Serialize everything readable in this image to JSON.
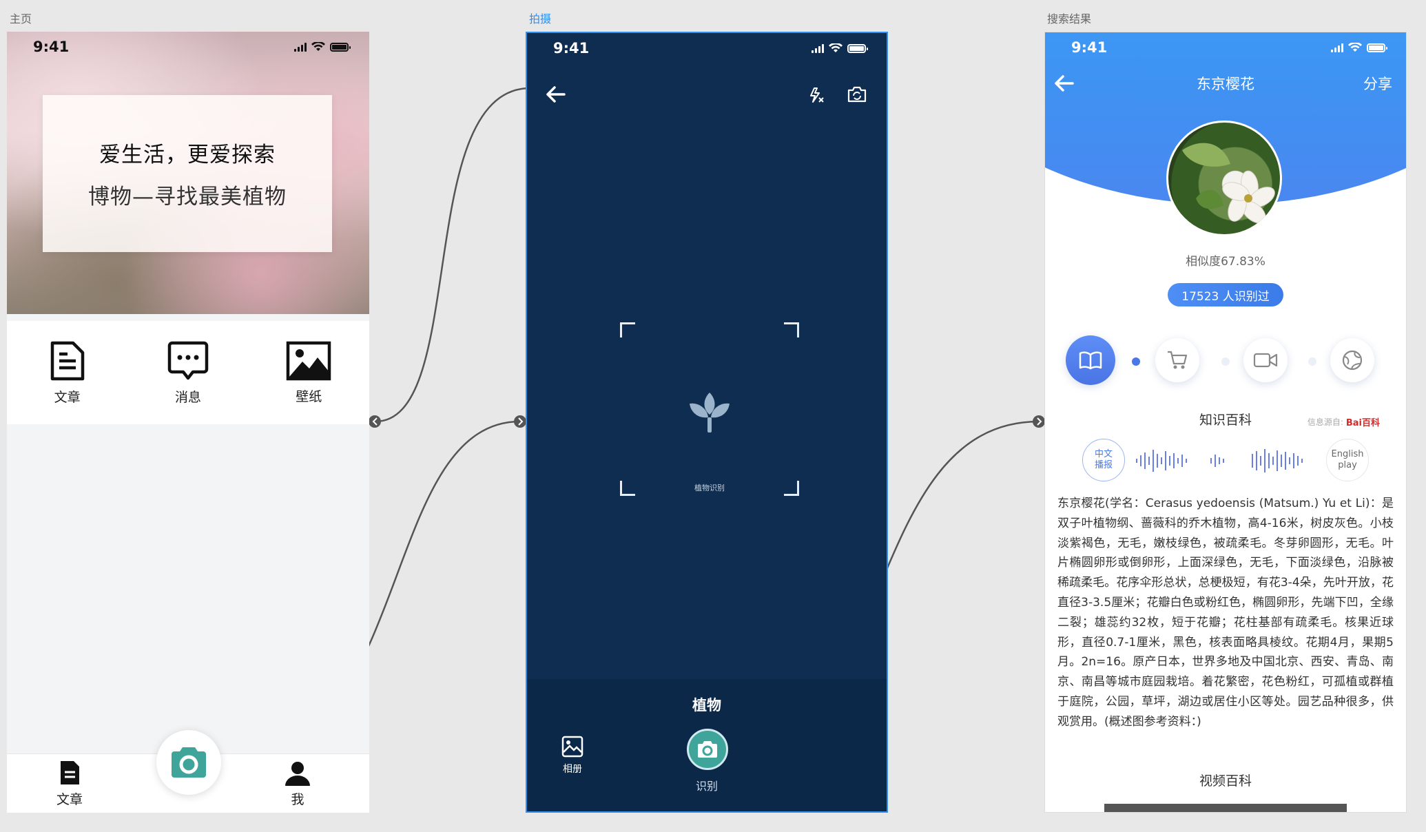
{
  "frames": {
    "home_label": "主页",
    "camera_label": "拍摄",
    "result_label": "搜索结果"
  },
  "status": {
    "time": "9:41"
  },
  "home": {
    "slogan_line1": "爱生活，更爱探索",
    "slogan_line2": "博物—寻找最美植物",
    "quick": [
      {
        "label": "文章",
        "icon": "document-icon"
      },
      {
        "label": "消息",
        "icon": "message-icon"
      },
      {
        "label": "壁纸",
        "icon": "image-icon"
      }
    ],
    "tabs": [
      {
        "label": "文章",
        "icon": "document-icon"
      },
      {
        "label": "我",
        "icon": "user-icon"
      }
    ],
    "camera_button_icon": "camera-icon"
  },
  "camera": {
    "viewfinder_caption": "植物识别",
    "mode": "植物",
    "album_label": "相册",
    "shutter_label": "识别"
  },
  "result": {
    "title": "东京樱花",
    "share": "分享",
    "similarity": "相似度67.83%",
    "recognized_count": "17523 人识别过",
    "section_knowledge": "知识百科",
    "source_prefix": "信息源自:",
    "source_brand": "Bai百科",
    "chinese_play": "中文播报",
    "english_play": "English play",
    "description": "东京樱花(学名：Cerasus yedoensis (Matsum.) Yu et Li)：是双子叶植物纲、蔷薇科的乔木植物，高4-16米，树皮灰色。小枝淡紫褐色，无毛，嫩枝绿色，被疏柔毛。冬芽卵圆形，无毛。叶片椭圆卵形或倒卵形，上面深绿色，无毛，下面淡绿色，沿脉被稀疏柔毛。花序伞形总状，总梗极短，有花3-4朵，先叶开放，花直径3-3.5厘米；花瓣白色或粉红色，椭圆卵形，先端下凹，全缘二裂；雄蕊约32枚，短于花瓣；花柱基部有疏柔毛。核果近球形，直径0.7-1厘米，黑色，核表面略具棱纹。花期4月，果期5月。2n=16。原产日本，世界多地及中国北京、西安、青岛、南京、南昌等城市庭园栽培。着花繁密，花色粉红，可孤植或群植于庭院，公园，草坪，湖边或居住小区等处。园艺品种很多，供观赏用。(概述图参考资料：)",
    "section_video": "视频百科"
  },
  "colors": {
    "selected_frame": "#2f8ef0",
    "camera_bg": "#0e2d50",
    "result_header": "#3d94f3",
    "camera_green": "#3fa49a"
  }
}
